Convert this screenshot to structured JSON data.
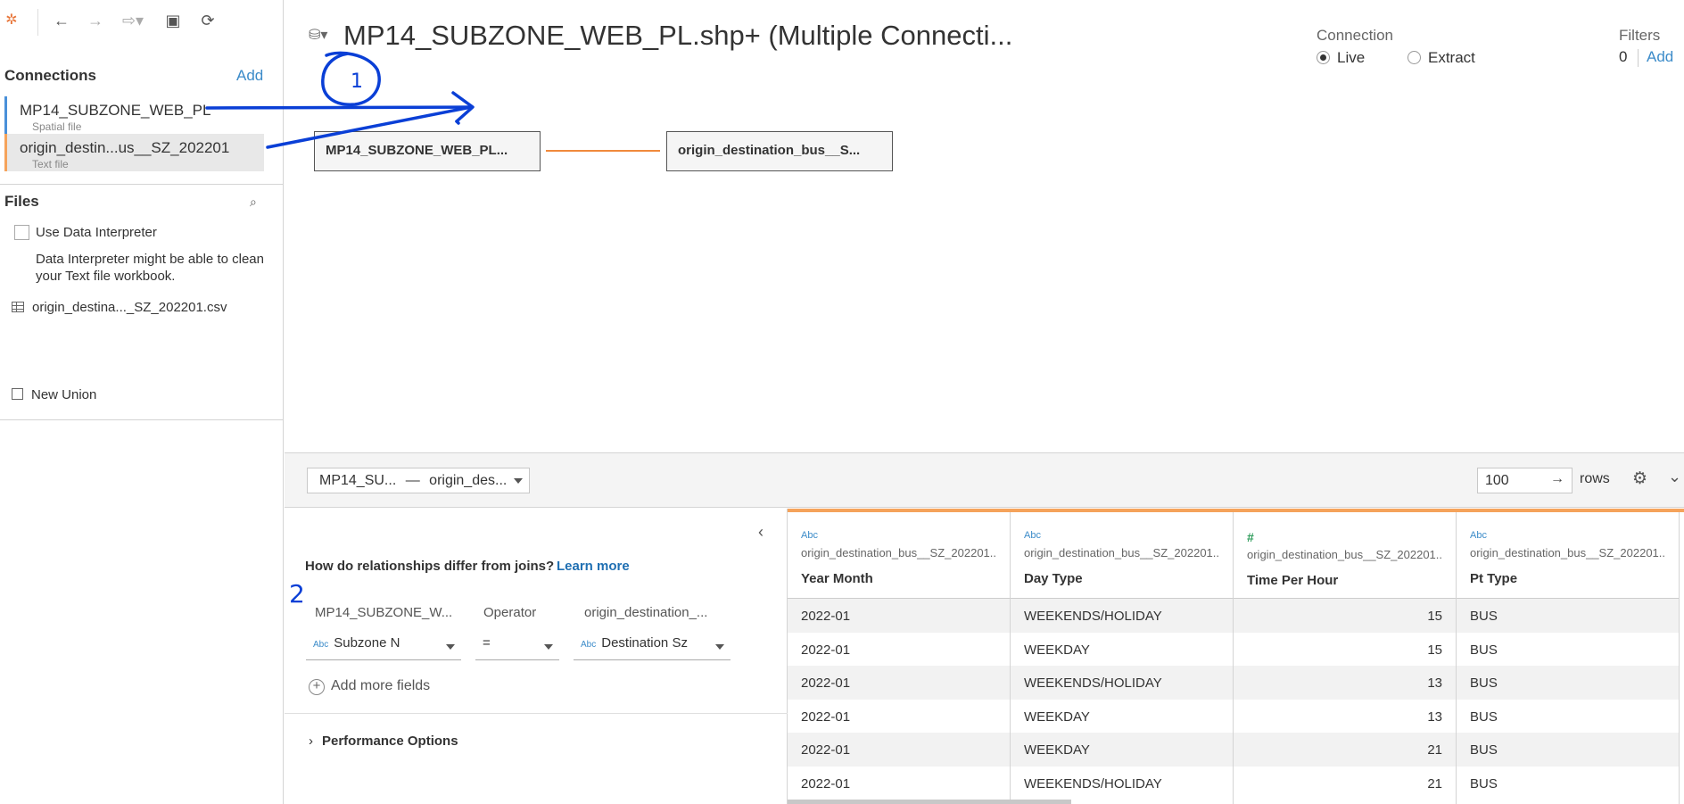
{
  "sidebar": {
    "connections_heading": "Connections",
    "connections_add": "Add",
    "connections": [
      {
        "name": "MP14_SUBZONE_WEB_PL",
        "type": "Spatial file"
      },
      {
        "name": "origin_destin...us__SZ_202201",
        "type": "Text file"
      }
    ],
    "files_heading": "Files",
    "use_interpreter_label": "Use Data Interpreter",
    "interpreter_note": "Data Interpreter might be able to clean your Text file workbook.",
    "file_name": "origin_destina..._SZ_202201.csv",
    "new_union": "New Union"
  },
  "canvas": {
    "datasource_title": "MP14_SUBZONE_WEB_PL.shp+ (Multiple Connecti...",
    "connection_heading": "Connection",
    "live_label": "Live",
    "extract_label": "Extract",
    "connection_mode": "Live",
    "filters_heading": "Filters",
    "filters_count": "0",
    "filters_add": "Add",
    "left_table": "MP14_SUBZONE_WEB_PL...",
    "right_table": "origin_destination_bus__S..."
  },
  "relationship_bar": {
    "selected_left": "MP14_SU...",
    "separator": "—",
    "selected_right": "origin_des...",
    "rows_value": "100",
    "rows_label": "rows"
  },
  "relationship_panel": {
    "question": "How do relationships differ from joins?",
    "learn_more": "Learn more",
    "left_header": "MP14_SUBZONE_W...",
    "operator_header": "Operator",
    "right_header": "origin_destination_...",
    "left_field": "Subzone N",
    "operator": "=",
    "right_field": "Destination Sz",
    "type_abc": "Abc",
    "add_more": "Add more fields",
    "performance": "Performance Options"
  },
  "grid": {
    "type_abc": "Abc",
    "type_num": "#",
    "columns": [
      {
        "source": "origin_destination_bus__SZ_202201...",
        "name": "Year Month"
      },
      {
        "source": "origin_destination_bus__SZ_202201...",
        "name": "Day Type"
      },
      {
        "source": "origin_destination_bus__SZ_202201...",
        "name": "Time Per Hour"
      },
      {
        "source": "origin_destination_bus__SZ_202201...",
        "name": "Pt Type"
      }
    ],
    "rows": [
      [
        "2022-01",
        "WEEKENDS/HOLIDAY",
        "15",
        "BUS"
      ],
      [
        "2022-01",
        "WEEKDAY",
        "15",
        "BUS"
      ],
      [
        "2022-01",
        "WEEKENDS/HOLIDAY",
        "13",
        "BUS"
      ],
      [
        "2022-01",
        "WEEKDAY",
        "13",
        "BUS"
      ],
      [
        "2022-01",
        "WEEKDAY",
        "21",
        "BUS"
      ],
      [
        "2022-01",
        "WEEKENDS/HOLIDAY",
        "21",
        "BUS"
      ]
    ]
  },
  "annotations": {
    "label_1": "1",
    "label_2": "2",
    "color": "#0a3fd6"
  },
  "colors": {
    "link": "#3b8bc9",
    "relationship_line": "#f08a3c",
    "connection_1_accent": "#4a90d9",
    "connection_2_accent": "#f5a35b"
  }
}
